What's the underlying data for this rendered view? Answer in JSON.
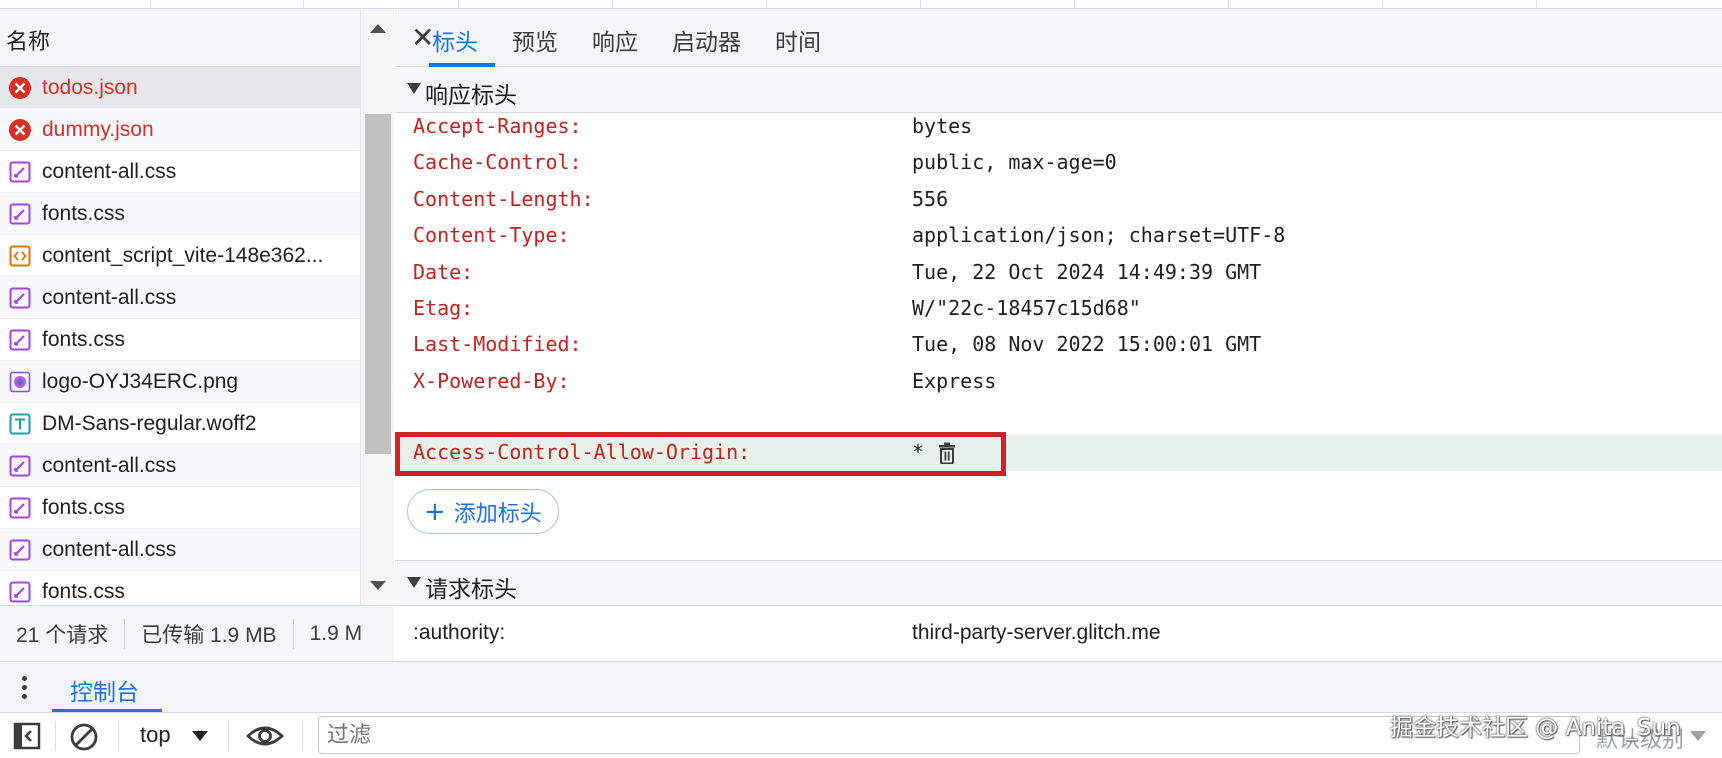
{
  "request_list": {
    "column_title": "名称",
    "items": [
      {
        "name": "todos.json",
        "type": "error",
        "icon": "error-icon"
      },
      {
        "name": "dummy.json",
        "type": "error",
        "icon": "error-icon"
      },
      {
        "name": "content-all.css",
        "type": "css",
        "icon": "stylesheet-icon"
      },
      {
        "name": "fonts.css",
        "type": "css",
        "icon": "stylesheet-icon"
      },
      {
        "name": "content_script_vite-148e362...",
        "type": "script",
        "icon": "script-icon"
      },
      {
        "name": "content-all.css",
        "type": "css",
        "icon": "stylesheet-icon"
      },
      {
        "name": "fonts.css",
        "type": "css",
        "icon": "stylesheet-icon"
      },
      {
        "name": "logo-OYJ34ERC.png",
        "type": "image",
        "icon": "image-icon"
      },
      {
        "name": "DM-Sans-regular.woff2",
        "type": "font",
        "icon": "font-icon"
      },
      {
        "name": "content-all.css",
        "type": "css",
        "icon": "stylesheet-icon"
      },
      {
        "name": "fonts.css",
        "type": "css",
        "icon": "stylesheet-icon"
      },
      {
        "name": "content-all.css",
        "type": "css",
        "icon": "stylesheet-icon"
      },
      {
        "name": "fonts.css",
        "type": "css",
        "icon": "stylesheet-icon"
      }
    ]
  },
  "status": {
    "requests": "21 个请求",
    "transferred": "已传输 1.9 MB",
    "resources": "1.9 M"
  },
  "detail_tabs": {
    "close_icon": "close-icon",
    "items": [
      "标头",
      "预览",
      "响应",
      "启动器",
      "时间"
    ],
    "active": "标头"
  },
  "response_headers": {
    "title": "响应标头",
    "rows": [
      {
        "key": "Accept-Ranges:",
        "value": "bytes"
      },
      {
        "key": "Cache-Control:",
        "value": "public, max-age=0"
      },
      {
        "key": "Content-Length:",
        "value": "556"
      },
      {
        "key": "Content-Type:",
        "value": "application/json; charset=UTF-8"
      },
      {
        "key": "Date:",
        "value": "Tue, 22 Oct 2024 14:49:39 GMT"
      },
      {
        "key": "Etag:",
        "value": "W/\"22c-18457c15d68\""
      },
      {
        "key": "Last-Modified:",
        "value": "Tue, 08 Nov 2022 15:00:01 GMT"
      },
      {
        "key": "X-Powered-By:",
        "value": "Express"
      }
    ],
    "override_row": {
      "key": "Access-Control-Allow-Origin:",
      "value": "*"
    },
    "add_button": "添加标头"
  },
  "request_headers": {
    "title": "请求标头",
    "rows": [
      {
        "key": ":authority:",
        "value": "third-party-server.glitch.me"
      }
    ]
  },
  "drawer": {
    "tab": "控制台"
  },
  "console_toolbar": {
    "context": "top",
    "filter_placeholder": "过滤",
    "level": "默认级别"
  },
  "watermark": "掘金技术社区 @ Anita_Sun",
  "colors": {
    "accent": "#1a73e8",
    "error": "#d93025",
    "header_key": "#c5221f",
    "highlight_box": "#d61f26"
  }
}
